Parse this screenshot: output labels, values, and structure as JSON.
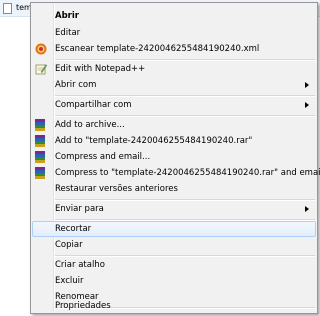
{
  "background": {
    "file_label": "tem"
  },
  "context_menu": {
    "items": [
      {
        "label": "Abrir",
        "bold": true
      },
      {
        "label": "Editar"
      },
      {
        "label": "Escanear template-2420046255484190240.xml",
        "icon": "antivirus-scan-icon"
      },
      {
        "label": "Edit with Notepad++",
        "icon": "notepad-plus-plus-icon"
      },
      {
        "label": "Abrir com",
        "submenu": true
      },
      {
        "label": "Compartilhar com",
        "submenu": true
      },
      {
        "label": "Add to archive...",
        "icon": "winrar-icon"
      },
      {
        "label": "Add to \"template-2420046255484190240.rar\"",
        "icon": "winrar-icon"
      },
      {
        "label": "Compress and email...",
        "icon": "winrar-icon"
      },
      {
        "label": "Compress to \"template-2420046255484190240.rar\" and email",
        "icon": "winrar-icon"
      },
      {
        "label": "Restaurar versões anteriores"
      },
      {
        "label": "Enviar para",
        "submenu": true
      },
      {
        "label": "Recortar",
        "highlighted": true
      },
      {
        "label": "Copiar"
      },
      {
        "label": "Criar atalho"
      },
      {
        "label": "Excluir"
      },
      {
        "label": "Renomear"
      },
      {
        "label": "Propriedades"
      }
    ]
  },
  "colors": {
    "menu_background": "#f1f1f1",
    "hover_border": "#aecff7",
    "scan_icon": "#e8730c",
    "winrar_stack": [
      "#7b2a8c",
      "#2f5fb3",
      "#2e8b3a",
      "#c8a21c"
    ]
  }
}
